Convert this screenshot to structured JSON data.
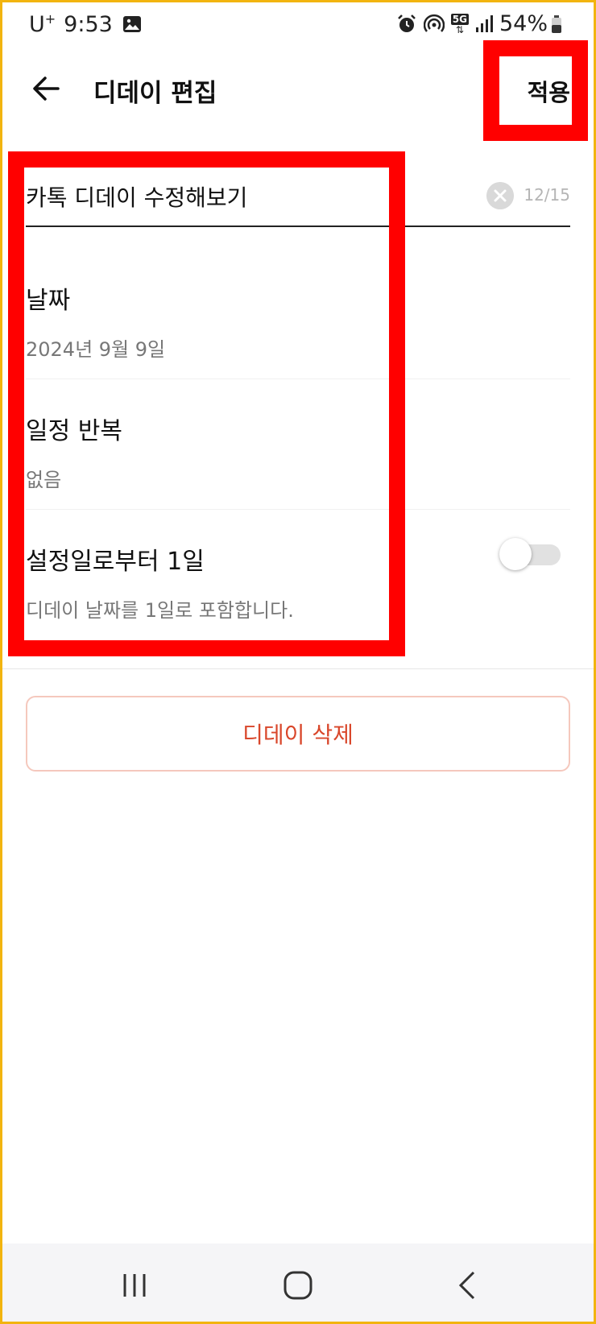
{
  "status_bar": {
    "carrier": "U",
    "carrier_plus": "+",
    "time": "9:53",
    "network": "5G",
    "battery": "54%",
    "icons": [
      "gallery-icon",
      "alarm-icon",
      "hotspot-icon",
      "5g-data-icon",
      "signal-icon",
      "battery-icon"
    ]
  },
  "header": {
    "title": "디데이 편집",
    "apply_label": "적용"
  },
  "name_field": {
    "value": "카톡 디데이 수정해보기",
    "count": "12/15"
  },
  "date_section": {
    "title": "날짜",
    "value": "2024년 9월 9일"
  },
  "repeat_section": {
    "title": "일정 반복",
    "value": "없음"
  },
  "count_section": {
    "title": "설정일로부터 1일",
    "description": "디데이 날짜를 1일로 포함합니다.",
    "toggle_on": false
  },
  "delete_label": "디데이 삭제",
  "colors": {
    "highlight": "#ff0000",
    "frame": "#f2b40f",
    "delete_text": "#d9472b",
    "delete_border": "#f5c8bd"
  }
}
